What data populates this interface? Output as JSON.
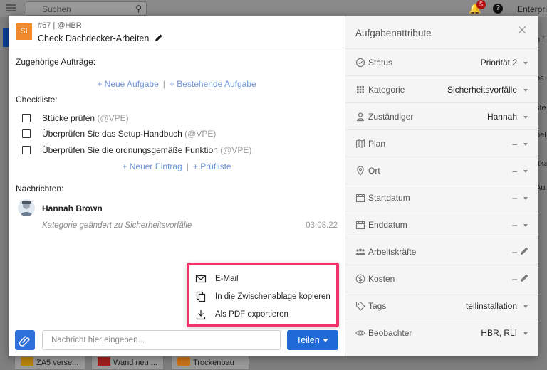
{
  "background": {
    "search_placeholder": "Suchen",
    "notifications_count": "5",
    "help_label": "?",
    "user_label": "Enterpri",
    "bottom_chips": [
      "ZA5 verse...",
      "Wand neu ...",
      "Trockenbau"
    ],
    "side_texts": [
      "n f",
      "os",
      "ste",
      "bel",
      "ftka",
      "Au"
    ]
  },
  "task": {
    "avatar_initials": "SI",
    "reference": "#67 | @HBR",
    "title": "Check Dachdecker-Arbeiten"
  },
  "related_orders": {
    "label": "Zugehörige Aufträge:",
    "new_task_link": "+ Neue Aufgabe",
    "separator": "|",
    "existing_task_link": "+ Bestehende Aufgabe"
  },
  "checklist": {
    "label": "Checkliste:",
    "items": [
      {
        "text": "Stücke prüfen",
        "user": "(@VPE)"
      },
      {
        "text": "Überprüfen Sie das Setup-Handbuch",
        "user": "(@VPE)"
      },
      {
        "text": "Überprüfen Sie die ordnungsgemäße Funktion",
        "user": "(@VPE)"
      }
    ],
    "new_entry_link": "+ Neuer Eintrag",
    "checklist_link": "+ Prüfliste"
  },
  "messages": {
    "label": "Nachrichten:",
    "items": [
      {
        "author": "Hannah Brown",
        "text": "Kategorie geändert zu Sicherheitsvorfälle",
        "date": "03.08.22"
      }
    ]
  },
  "share_menu": {
    "items": [
      {
        "icon": "envelope-icon",
        "label": "E-Mail"
      },
      {
        "icon": "copy-icon",
        "label": "In die Zwischenablage kopieren"
      },
      {
        "icon": "download-pdf-icon",
        "label": "Als PDF exportieren"
      }
    ]
  },
  "composer": {
    "placeholder": "Nachricht hier eingeben...",
    "share_button": "Teilen"
  },
  "attributes": {
    "title": "Aufgabenattribute",
    "rows": [
      {
        "icon": "status-check-icon",
        "name": "Status",
        "value": "Priorität 2",
        "control": "dropdown"
      },
      {
        "icon": "grid-icon",
        "name": "Kategorie",
        "value": "Sicherheitsvorfälle",
        "control": "dropdown"
      },
      {
        "icon": "person-icon",
        "name": "Zuständiger",
        "value": "Hannah",
        "control": "dropdown"
      },
      {
        "icon": "map-icon",
        "name": "Plan",
        "value": "–",
        "control": "dropdown"
      },
      {
        "icon": "location-pin-icon",
        "name": "Ort",
        "value": "–",
        "control": "dropdown"
      },
      {
        "icon": "calendar-icon",
        "name": "Startdatum",
        "value": "–",
        "control": "dropdown"
      },
      {
        "icon": "calendar-icon",
        "name": "Enddatum",
        "value": "–",
        "control": "dropdown"
      },
      {
        "icon": "people-icon",
        "name": "Arbeitskräfte",
        "value": "–",
        "control": "edit"
      },
      {
        "icon": "dollar-icon",
        "name": "Kosten",
        "value": "–",
        "control": "edit"
      },
      {
        "icon": "tag-icon",
        "name": "Tags",
        "value": "teilinstallation",
        "control": "dropdown"
      },
      {
        "icon": "eye-icon",
        "name": "Beobachter",
        "value": "HBR, RLI",
        "control": "dropdown"
      }
    ]
  },
  "colors": {
    "accent": "#1f6ad6",
    "highlight_border": "#f0336a",
    "avatar": "#f08a2c",
    "link": "#6f95d6"
  }
}
